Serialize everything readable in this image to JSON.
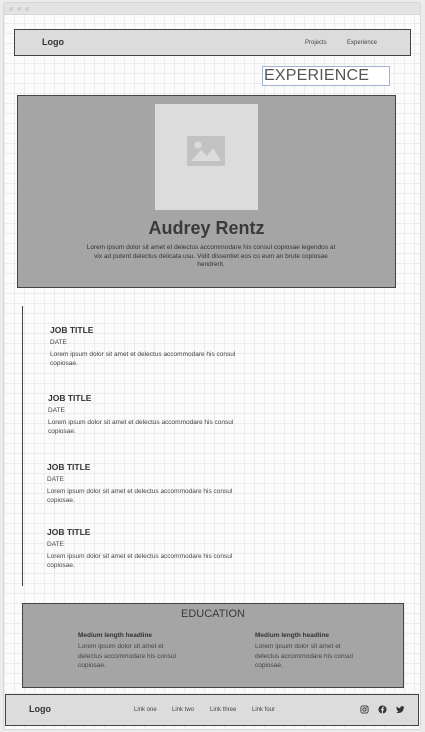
{
  "nav": {
    "logo": "Logo",
    "links": [
      "Projects",
      "Experience"
    ]
  },
  "page_title": "EXPERIENCE",
  "hero": {
    "image_icon": "image-placeholder-icon",
    "name": "Audrey Rentz",
    "bio": "Lorem ipsum dolor sit amet et delectus accommodare his consul copiosae legendos at vix ad putent delectus delicata usu. Vidit dissentiet eos cu eum an brute copiosae hendrerit."
  },
  "jobs": [
    {
      "title": "JOB TITLE",
      "date": "DATE",
      "desc": "Lorem ipsum dolor sit amet et delectus accommodare his consul copiosae."
    },
    {
      "title": "JOB TITLE",
      "date": "DATE",
      "desc": "Lorem ipsum dolor sit amet et delectus accommodare his consul copiosae."
    },
    {
      "title": "JOB TITLE",
      "date": "DATE",
      "desc": "Lorem ipsum dolor sit amet et delectus accommodare his consul copiosae."
    },
    {
      "title": "JOB TITLE",
      "date": "DATE",
      "desc": "Lorem ipsum dolor sit amet et delectus accommodare his consul copiosae."
    }
  ],
  "education": {
    "title": "EDUCATION",
    "items": [
      {
        "headline": "Medium length headline",
        "desc": "Lorem ipsum dolor sit amet et delectus accommodare his consul copiosae."
      },
      {
        "headline": "Medium length headline",
        "desc": "Lorem ipsum dolor sit amet et delectus accommodare his consul copiosae."
      }
    ]
  },
  "footer": {
    "logo": "Logo",
    "links": [
      "Link one",
      "Link two",
      "Link three",
      "Link four"
    ],
    "social_icons": [
      "instagram-icon",
      "facebook-icon",
      "twitter-icon"
    ]
  },
  "colors": {
    "panel_fill": "#a5a5a5",
    "bar_fill": "#dcdcdc",
    "border": "#444444",
    "title_box_border": "#9fb5d6"
  }
}
